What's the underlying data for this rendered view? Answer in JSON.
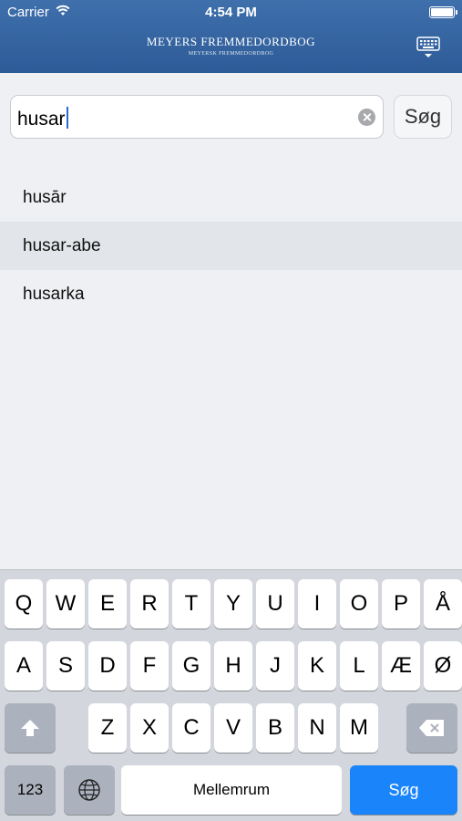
{
  "status_bar": {
    "carrier": "Carrier",
    "time": "4:54 PM"
  },
  "header": {
    "title": "MEYERS FREMMEDORDBOG",
    "subtitle": "MEYERSK FREMMEDORDBOG",
    "keyboard_toggle_icon": "keyboard-dismiss-icon"
  },
  "search": {
    "value": "husar",
    "placeholder": "",
    "button_label": "Søg"
  },
  "results": [
    {
      "label": "husār",
      "selected": false
    },
    {
      "label": "husar-abe",
      "selected": true
    },
    {
      "label": "husarka",
      "selected": false
    }
  ],
  "keyboard": {
    "row1": [
      "Q",
      "W",
      "E",
      "R",
      "T",
      "Y",
      "U",
      "I",
      "O",
      "P",
      "Å"
    ],
    "row2": [
      "A",
      "S",
      "D",
      "F",
      "G",
      "H",
      "J",
      "K",
      "L",
      "Æ",
      "Ø"
    ],
    "row3": [
      "Z",
      "X",
      "C",
      "V",
      "B",
      "N",
      "M"
    ],
    "numbers_key": "123",
    "space_key": "Mellemrum",
    "go_key": "Søg",
    "accent_color": "#1a84fb"
  }
}
